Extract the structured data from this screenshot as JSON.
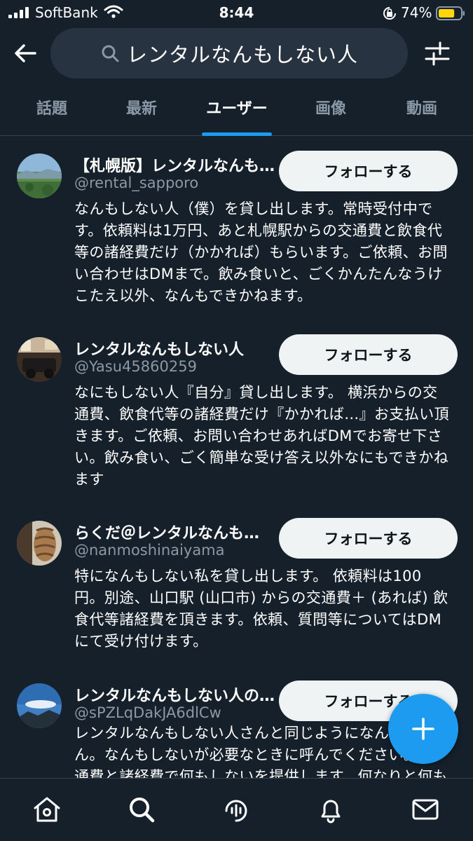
{
  "status_bar": {
    "carrier": "SoftBank",
    "time": "8:44",
    "battery_percent": "74%",
    "battery_level": 0.74,
    "battery_color": "#ffd60a",
    "icons": [
      "signal-icon",
      "wifi-icon",
      "orientation-lock-icon",
      "battery-icon"
    ]
  },
  "header": {
    "back_icon": "back-arrow-icon",
    "search_query": "レンタルなんもしない人",
    "search_icon": "search-icon",
    "filter_icon": "filter-sliders-icon"
  },
  "tabs": [
    {
      "label": "話題",
      "active": false
    },
    {
      "label": "最新",
      "active": false
    },
    {
      "label": "ユーザー",
      "active": true
    },
    {
      "label": "画像",
      "active": false
    },
    {
      "label": "動画",
      "active": false
    }
  ],
  "results": [
    {
      "name": "【札幌版】レンタルなんも…",
      "handle": "@rental_sapporo",
      "follow_label": "フォローする",
      "bio_lines": [
        "なんもしない人（僕）を貸し出します。常時受付中で",
        "す。依頼料は1万円、あと札幌駅からの交通費と飲食代",
        "等の諸経費だけ（かかれば）もらいます。ご依頼、お問",
        "い合わせはDMまで。飲み食いと、ごくかんたんなうけ",
        "こたえ以外、なんもできかねます。"
      ]
    },
    {
      "name": "レンタルなんもしない人",
      "handle": "@Yasu45860259",
      "follow_label": "フォローする",
      "bio_lines": [
        "なにもしない人『自分』貸し出します。 横浜からの交",
        "通費、飲食代等の諸経費だけ『かかれば…』お支払い頂",
        "きます。ご依頼、お問い合わせあればDMでお寄せ下さ",
        "い。飲み食い、ごく簡単な受け答え以外なにもできかね",
        "ます"
      ]
    },
    {
      "name": "らくだ＠レンタルなんも…",
      "handle": "@nanmoshinaiyama",
      "follow_label": "フォローする",
      "bio_lines": [
        "特になんもしない私を貸し出します。 依頼料は100",
        "円。別途、山口駅 (山口市) からの交通費＋ (あれば) 飲",
        "食代等諸経費を頂きます。依頼、質問等についてはDM",
        "にて受け付けます。"
      ]
    },
    {
      "name": "レンタルなんもしない人の…",
      "handle": "@sPZLqDakJA6dlCw",
      "follow_label": "フォローする",
      "bio_lines": [
        "レンタルなんもしない人さんと同じようになん",
        "ん。なんもしないが必要なときに呼んでください。交",
        "通費と諸経費で何もしないを提供します。何なりと何も"
      ]
    }
  ],
  "fab": {
    "icon": "compose-plus-icon"
  },
  "bottom_nav": [
    {
      "icon": "home-icon"
    },
    {
      "icon": "search-icon"
    },
    {
      "icon": "spaces-icon"
    },
    {
      "icon": "notifications-bell-icon"
    },
    {
      "icon": "messages-envelope-icon"
    }
  ],
  "colors": {
    "background": "#15202b",
    "accent": "#1d9bf0",
    "secondary_text": "#8b98a5",
    "follow_button_bg": "#eff3f4"
  }
}
